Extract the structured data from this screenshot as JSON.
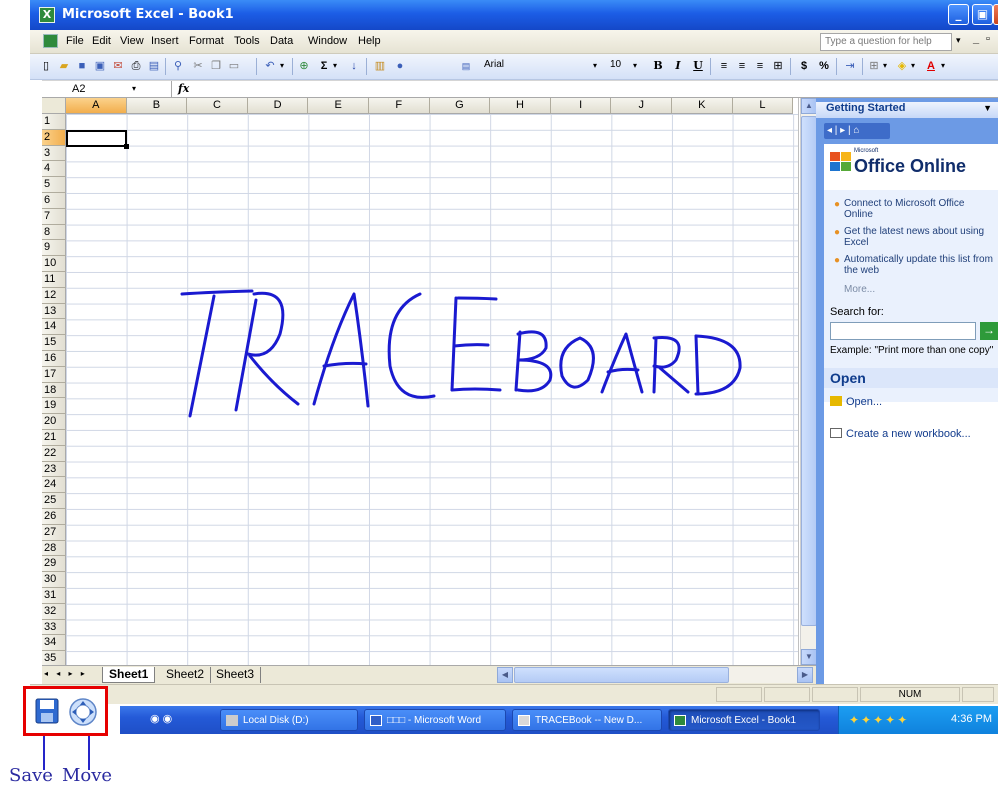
{
  "window": {
    "title": "Microsoft Excel - Book1",
    "app_icon": "X",
    "minimize_label": "_",
    "restore_label": "▣",
    "close_label": "X"
  },
  "menu": {
    "items": [
      "File",
      "Edit",
      "View",
      "Insert",
      "Format",
      "Tools",
      "Data",
      "Window",
      "Help"
    ],
    "help_placeholder": "Type a question for help",
    "help_dropdown": "▾",
    "doc_minimize": "_",
    "doc_restore": "▫"
  },
  "toolbar": {
    "font_name": "Arial",
    "font_size": "10",
    "bold": "B",
    "italic": "I",
    "underline": "U",
    "currency": "$",
    "percent": "%",
    "sum": "Σ",
    "font_color_letter": "A"
  },
  "formula_bar": {
    "name_box": "A2",
    "name_box_arrow": "▾",
    "fx": "fx",
    "formula": ""
  },
  "grid": {
    "columns": [
      "A",
      "B",
      "C",
      "D",
      "E",
      "F",
      "G",
      "H",
      "I",
      "J",
      "K",
      "L"
    ],
    "rows": [
      "1",
      "2",
      "3",
      "4",
      "5",
      "6",
      "7",
      "8",
      "9",
      "10",
      "11",
      "12",
      "13",
      "14",
      "15",
      "16",
      "17",
      "18",
      "19",
      "20",
      "21",
      "22",
      "23",
      "24",
      "25",
      "26",
      "27",
      "28",
      "29",
      "30",
      "31",
      "32",
      "33",
      "34",
      "35"
    ],
    "active_cell": "A2",
    "active_column": "A",
    "active_row": "2",
    "ink_text_large": "TRACE",
    "ink_text_small": "BOARD",
    "ink_color": "#1a1ad0"
  },
  "sheets": {
    "nav": "◂ ◂ ▸ ▸",
    "tabs": [
      "Sheet1",
      "Sheet2",
      "Sheet3"
    ],
    "active": "Sheet1"
  },
  "status": {
    "num_lock": "NUM"
  },
  "task_pane": {
    "title": "Getting Started",
    "title_dropdown": "▼",
    "nav": "◂ | ▸ | ⌂",
    "logo_small": "Microsoft",
    "logo_text": "Office Online",
    "bullets": [
      "Connect to Microsoft Office Online",
      "Get the latest news about using Excel",
      "Automatically update this list from the web"
    ],
    "more": "More...",
    "search_label": "Search for:",
    "search_value": "",
    "search_go": "→",
    "example": "Example: \"Print more than one copy\"",
    "open_heading": "Open",
    "open_link": "Open...",
    "create_link": "Create a new workbook..."
  },
  "taskbar": {
    "buttons": [
      {
        "label": "Local Disk (D:)",
        "active": false
      },
      {
        "label": "□□□ - Microsoft Word",
        "active": false
      },
      {
        "label": "TRACEBook -- New D...",
        "active": false
      },
      {
        "label": "Microsoft Excel - Book1",
        "active": true
      }
    ],
    "clock": "4:36 PM"
  },
  "callout": {
    "save_caption": "Save",
    "move_caption": "Move",
    "border_color": "#e60000",
    "caption_color": "#2a2aa0"
  },
  "colors": {
    "title_bar": "#1c5de6",
    "toolbar_bg": "#d4e1f7",
    "taskpane_bg": "#6c9ae5",
    "taskbar": "#245ad8",
    "active_header": "#f2ae4d"
  }
}
